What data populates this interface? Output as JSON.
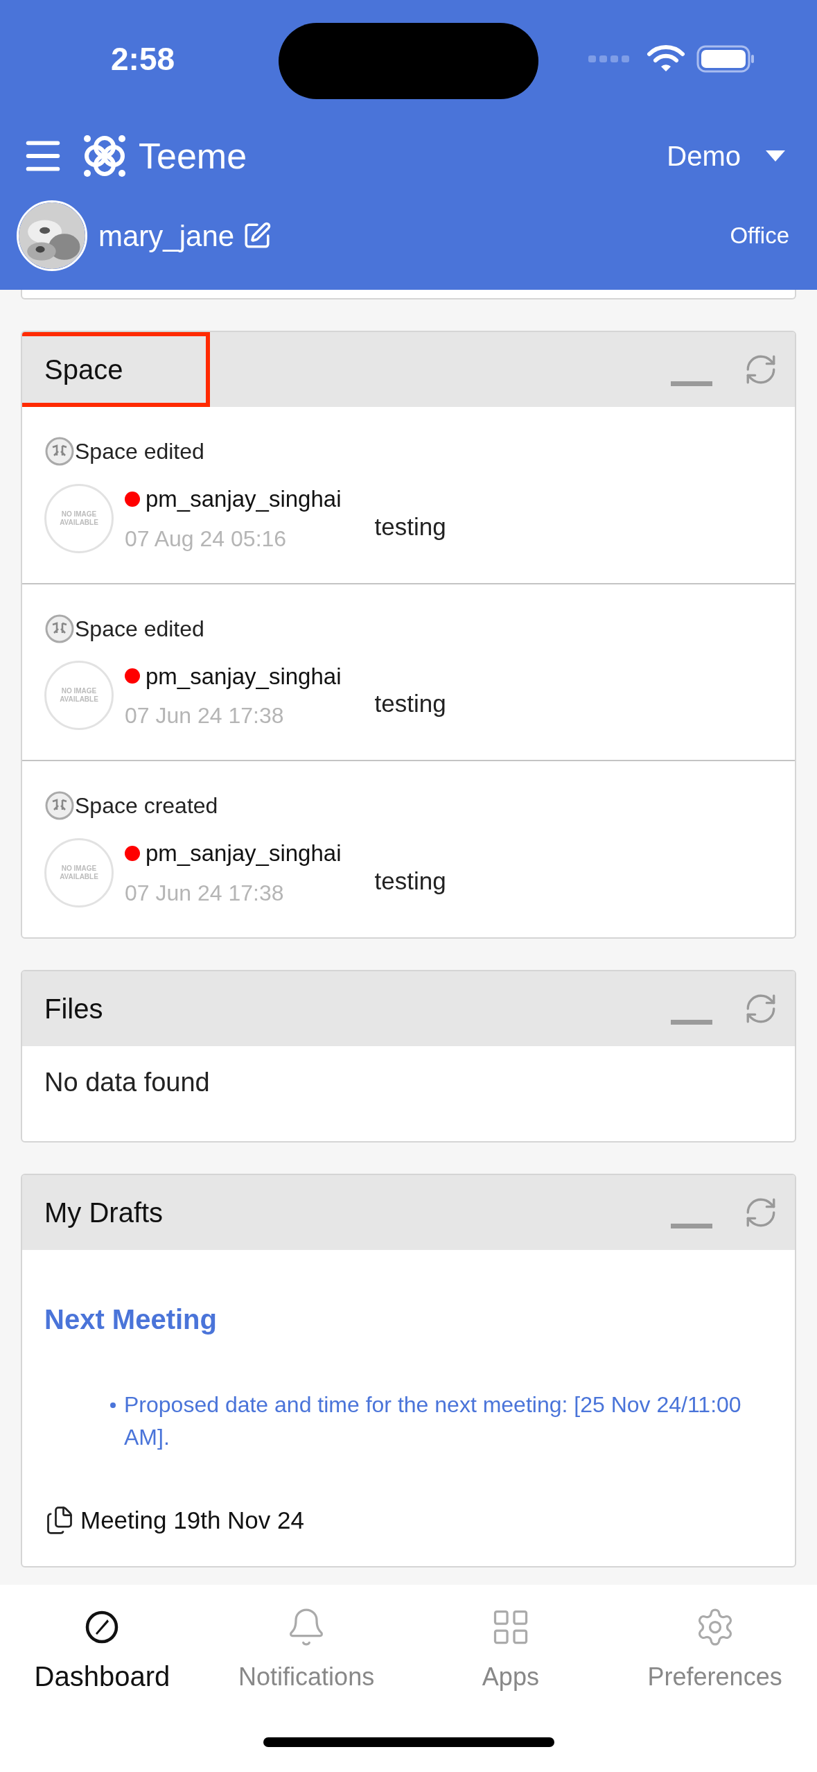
{
  "status_bar": {
    "time": "2:58"
  },
  "header": {
    "app_name": "Teeme",
    "workspace": "Demo",
    "username": "mary_jane",
    "location": "Office"
  },
  "cards": [
    {
      "kind": "activity",
      "title": "Space",
      "highlighted": true,
      "items": [
        {
          "action": "Space edited",
          "image_text": "NO IMAGE AVAILABLE",
          "user": "pm_sanjay_singhai",
          "time": "07 Aug 24 05:16",
          "name": "testing"
        },
        {
          "action": "Space edited",
          "image_text": "NO IMAGE AVAILABLE",
          "user": "pm_sanjay_singhai",
          "time": "07 Jun 24 17:38",
          "name": "testing"
        },
        {
          "action": "Space created",
          "image_text": "NO IMAGE AVAILABLE",
          "user": "pm_sanjay_singhai",
          "time": "07 Jun 24 17:38",
          "name": "testing"
        }
      ]
    },
    {
      "kind": "empty",
      "title": "Files",
      "highlighted": false,
      "message": "No data found"
    },
    {
      "kind": "drafts",
      "title": "My Drafts",
      "highlighted": false,
      "heading": "Next Meeting",
      "bullets": [
        "Proposed date and time for the next meeting: [25 Nov 24/11:00 AM]."
      ],
      "document": "Meeting 19th Nov 24"
    }
  ],
  "tabs": [
    {
      "label": "Dashboard",
      "selected": true
    },
    {
      "label": "Notifications",
      "selected": false
    },
    {
      "label": "Apps",
      "selected": false
    },
    {
      "label": "Preferences",
      "selected": false
    }
  ]
}
